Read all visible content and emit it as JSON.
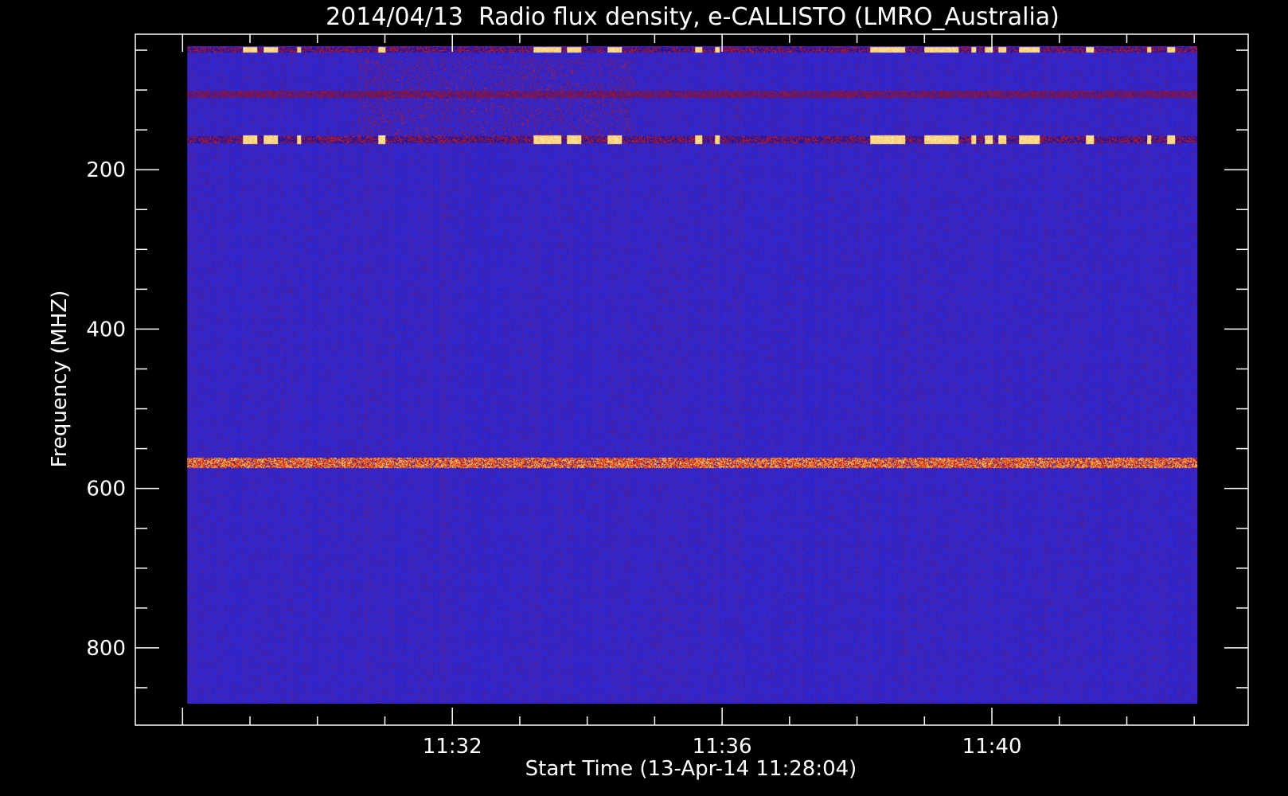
{
  "chart_data": {
    "type": "heatmap",
    "title": "2014/04/13  Radio flux density, e-CALLISTO (LMRO_Australia)",
    "xlabel": "Start Time (13-Apr-14 11:28:04)",
    "ylabel": "Frequency (MHZ)",
    "x_tick_labels": [
      "11:32",
      "11:36",
      "11:40"
    ],
    "x_ticks_minutes": [
      32,
      36,
      40
    ],
    "x_data_range_minutes": [
      28.07,
      43.05
    ],
    "xlim_minutes": [
      27.3,
      43.8
    ],
    "y_tick_labels": [
      "200",
      "400",
      "600",
      "800"
    ],
    "y_ticks": [
      200,
      400,
      600,
      800
    ],
    "y_data_range": [
      45,
      870
    ],
    "ylim": [
      30,
      897
    ],
    "y_inverted": true,
    "colormap": [
      "#1010a0",
      "#2a2ae0",
      "#7a1040",
      "#e02010",
      "#ff9a20",
      "#fff3b0"
    ],
    "background_color": "#2c2ce8",
    "emission_bands": [
      {
        "freq_center": 49,
        "freq_width": 6,
        "kind": "bursty",
        "intensity": 0.55
      },
      {
        "freq_center": 105,
        "freq_width": 8,
        "kind": "noisy",
        "intensity": 0.45
      },
      {
        "freq_center": 162,
        "freq_width": 7,
        "kind": "bursty",
        "intensity": 0.55
      },
      {
        "freq_center": 567,
        "freq_width": 12,
        "kind": "noisy",
        "intensity": 0.85
      }
    ],
    "burst_intervals_minutes": [
      [
        28.9,
        29.1
      ],
      [
        29.2,
        29.4
      ],
      [
        29.7,
        29.75
      ],
      [
        30.9,
        31.0
      ],
      [
        33.2,
        33.6
      ],
      [
        33.7,
        33.9
      ],
      [
        34.3,
        34.5
      ],
      [
        35.6,
        35.7
      ],
      [
        35.9,
        35.95
      ],
      [
        38.2,
        38.7
      ],
      [
        39.0,
        39.5
      ],
      [
        39.7,
        39.75
      ],
      [
        39.9,
        40.0
      ],
      [
        40.1,
        40.2
      ],
      [
        40.4,
        40.7
      ],
      [
        41.4,
        41.5
      ],
      [
        42.3,
        42.35
      ],
      [
        42.6,
        42.7
      ]
    ],
    "faint_region": {
      "freq_range": [
        60,
        160
      ],
      "time_minutes": [
        30.6,
        34.7
      ]
    }
  }
}
